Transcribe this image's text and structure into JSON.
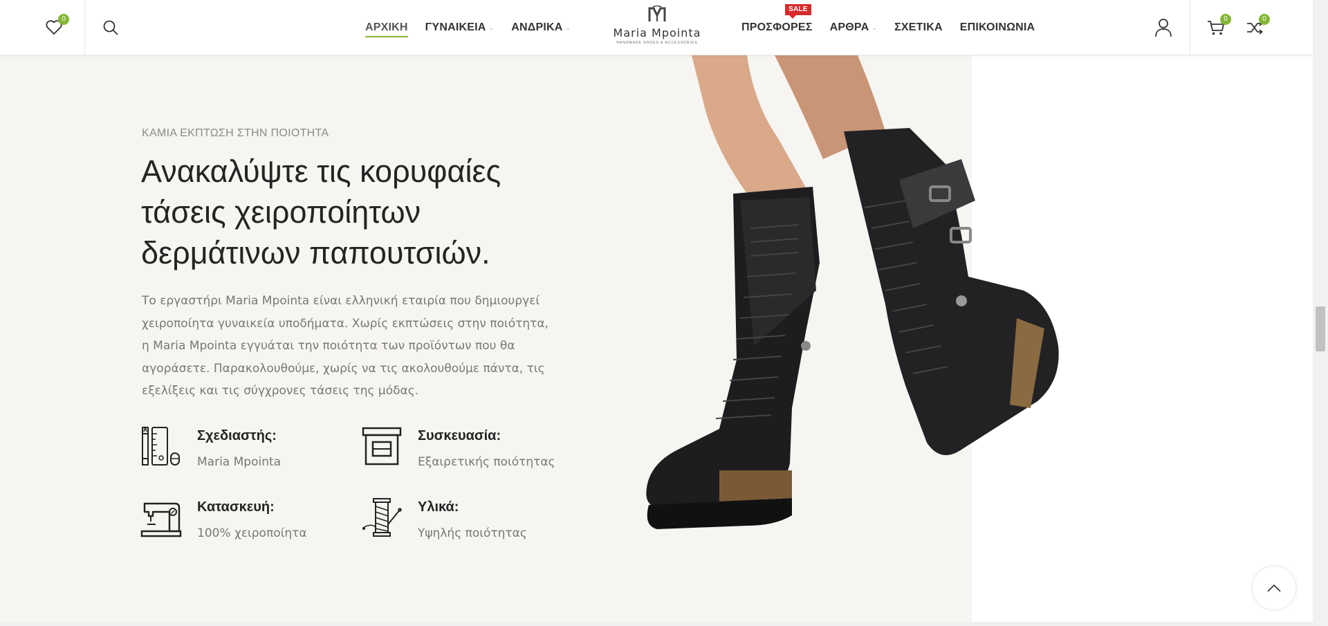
{
  "header": {
    "wishlist_count": "0",
    "cart_count": "0",
    "compare_count": "0",
    "nav_left": [
      {
        "label": "ΑΡΧΙΚΗ",
        "active": true,
        "has_dropdown": false
      },
      {
        "label": "ΓΥΝΑΙΚΕΙΑ",
        "active": false,
        "has_dropdown": true
      },
      {
        "label": "ΑΝΔΡΙΚΑ",
        "active": false,
        "has_dropdown": true
      }
    ],
    "nav_right": [
      {
        "label": "ΠΡΟΣΦΟΡΕΣ",
        "badge": "SALE",
        "has_dropdown": false
      },
      {
        "label": "ΑΡΘΡΑ",
        "has_dropdown": true
      },
      {
        "label": "ΣΧΕΤΙΚΑ",
        "has_dropdown": false
      },
      {
        "label": "ΕΠΙΚΟΙΝΩΝΙΑ",
        "has_dropdown": false
      }
    ],
    "logo": {
      "name": "Maria Mpointa",
      "tagline": "HANDMADE SHOES & ACCESSORIES"
    }
  },
  "hero": {
    "eyebrow": "ΚΑΜΙΑ ΕΚΠΤΩΣΗ ΣΤΗΝ ΠΟΙΟΤΗΤΑ",
    "title_lines": [
      "Ανακαλύψτε τις κορυφαίες",
      "τάσεις χειροποίητων",
      "δερμάτινων παπουτσιών."
    ],
    "description": "Το εργαστήρι Maria Mpointa είναι ελληνική εταιρία που δημιουργεί χειροποίητα γυναικεία υποδήματα. Χωρίς εκπτώσεις στην ποιότητα, η Maria Mpointa εγγυάται την ποιότητα των προϊόντων που θα αγοράσετε. Παρακολουθούμε, χωρίς να τις ακολουθούμε πάντα, τις εξελίξεις και τις σύγχρονες τάσεις της μόδας.",
    "features": [
      {
        "title": "Σχεδιαστής:",
        "value": "Maria Mpointa",
        "icon": "design-tools-icon"
      },
      {
        "title": "Συσκευασία:",
        "value": "Εξαιρετικής ποιότητας",
        "icon": "package-box-icon"
      },
      {
        "title": "Κατασκευή:",
        "value": "100% χειροποίητα",
        "icon": "sewing-machine-icon"
      },
      {
        "title": "Υλικά:",
        "value": "Υψηλής ποιότητας",
        "icon": "thread-spool-icon"
      }
    ]
  },
  "colors": {
    "accent": "#83b735",
    "sale": "#d62b2b",
    "hero_bg": "#f7f5f1"
  }
}
